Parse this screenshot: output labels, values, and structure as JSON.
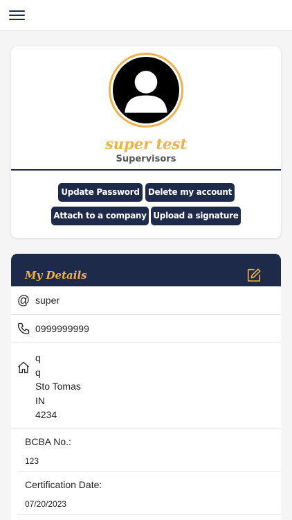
{
  "header": {
    "menu_icon": "hamburger-menu-icon"
  },
  "profile": {
    "avatar_icon": "user-avatar-icon",
    "name": "super test",
    "role": "Supervisors",
    "buttons": {
      "update_password": "Update Password",
      "delete_account": "Delete my account",
      "attach_company": "Attach to a company",
      "upload_signature": "Upload a signature"
    }
  },
  "details": {
    "title": "My Details",
    "edit_icon": "edit-icon",
    "email": {
      "icon": "at-icon",
      "icon_glyph": "@",
      "value": "super"
    },
    "phone": {
      "icon": "phone-icon",
      "value": "0999999999"
    },
    "address": {
      "icon": "home-icon",
      "lines": [
        "q",
        "q",
        "Sto Tomas",
        "IN",
        "4234"
      ]
    },
    "bcba": {
      "label": "BCBA No.:",
      "value": "123"
    },
    "certification": {
      "label": "Certification Date:",
      "value": "07/20/2023"
    }
  },
  "colors": {
    "navy": "#1e2a4a",
    "accent_gold": "#f0b14a",
    "background": "#f5f5f5"
  }
}
